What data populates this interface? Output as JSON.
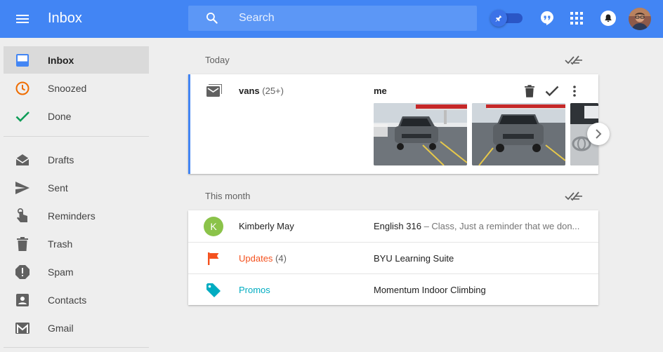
{
  "colors": {
    "topbar": "#4285f4",
    "accent_blue": "#4285f4",
    "snooze_orange": "#ef6c00",
    "done_green": "#0f9d58",
    "updates_orange": "#f4511e",
    "promos_teal": "#00acc1",
    "avatar_green": "#8bc34a"
  },
  "header": {
    "title": "Inbox",
    "search_placeholder": "Search",
    "icons": [
      "menu-icon",
      "search-icon",
      "pin-icon",
      "hangouts-icon",
      "apps-grid-icon",
      "notifications-icon",
      "avatar"
    ]
  },
  "sidebar": {
    "primary": [
      {
        "label": "Inbox",
        "icon": "inbox-icon",
        "active": true
      },
      {
        "label": "Snoozed",
        "icon": "clock-icon"
      },
      {
        "label": "Done",
        "icon": "check-icon"
      }
    ],
    "secondary": [
      {
        "label": "Drafts",
        "icon": "drafts-icon"
      },
      {
        "label": "Sent",
        "icon": "send-icon"
      },
      {
        "label": "Reminders",
        "icon": "reminder-hand-icon"
      },
      {
        "label": "Trash",
        "icon": "trash-icon"
      },
      {
        "label": "Spam",
        "icon": "spam-icon"
      },
      {
        "label": "Contacts",
        "icon": "contacts-icon"
      },
      {
        "label": "Gmail",
        "icon": "gmail-icon"
      }
    ]
  },
  "main": {
    "sections": [
      {
        "label": "Today",
        "bundle": {
          "name": "vans",
          "count": "(25+)",
          "sender": "me",
          "actions": [
            "trash-icon",
            "check-icon",
            "more-vert-icon"
          ],
          "thumbnails": [
            "minivan-photo-1",
            "minivan-photo-2",
            "minivan-photo-3"
          ]
        }
      },
      {
        "label": "This month",
        "rows": [
          {
            "name": "Kimberly May",
            "avatar_letter": "K",
            "subject": "English 316",
            "snippet": " – Class, Just a reminder that we don..."
          },
          {
            "name": "Updates",
            "count": "(4)",
            "subject": "BYU Learning Suite"
          },
          {
            "name": "Promos",
            "subject": "Momentum Indoor Climbing"
          }
        ]
      }
    ]
  }
}
